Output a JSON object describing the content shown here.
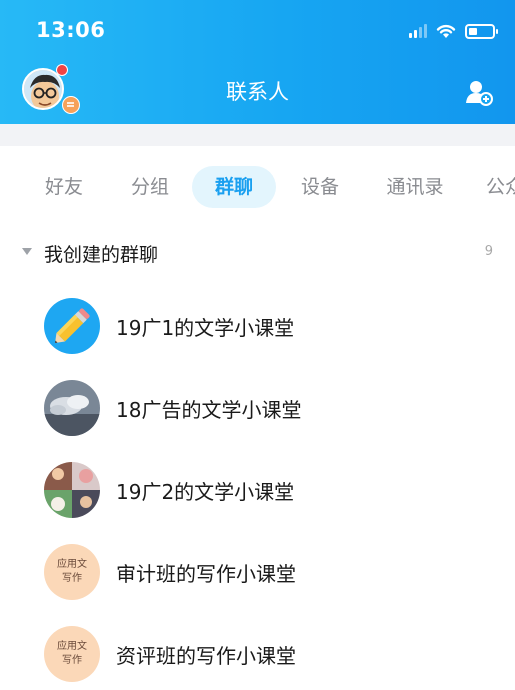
{
  "status_bar": {
    "time": "13:06"
  },
  "header": {
    "title": "联系人"
  },
  "tabs": [
    {
      "label": "好友",
      "active": false
    },
    {
      "label": "分组",
      "active": false
    },
    {
      "label": "群聊",
      "active": true
    },
    {
      "label": "设备",
      "active": false
    },
    {
      "label": "通讯录",
      "active": false
    },
    {
      "label": "公众号",
      "active": false
    }
  ],
  "section": {
    "title": "我创建的群聊",
    "count": "9"
  },
  "groups": [
    {
      "name": "19广1的文学小课堂",
      "icon": "pencil-icon"
    },
    {
      "name": "18广告的文学小课堂",
      "icon": "cloud-photo-icon"
    },
    {
      "name": "19广2的文学小课堂",
      "icon": "photo-collage-icon"
    },
    {
      "name": "审计班的写作小课堂",
      "icon": "writing-text-icon",
      "icon_text": [
        "应用文",
        "写作"
      ]
    },
    {
      "name": "资评班的写作小课堂",
      "icon": "writing-text-icon",
      "icon_text": [
        "应用文",
        "写作"
      ]
    }
  ],
  "colors": {
    "accent": "#1aa0f0",
    "header": "#17a6f2",
    "tab_active_bg": "#e3f5fd"
  }
}
